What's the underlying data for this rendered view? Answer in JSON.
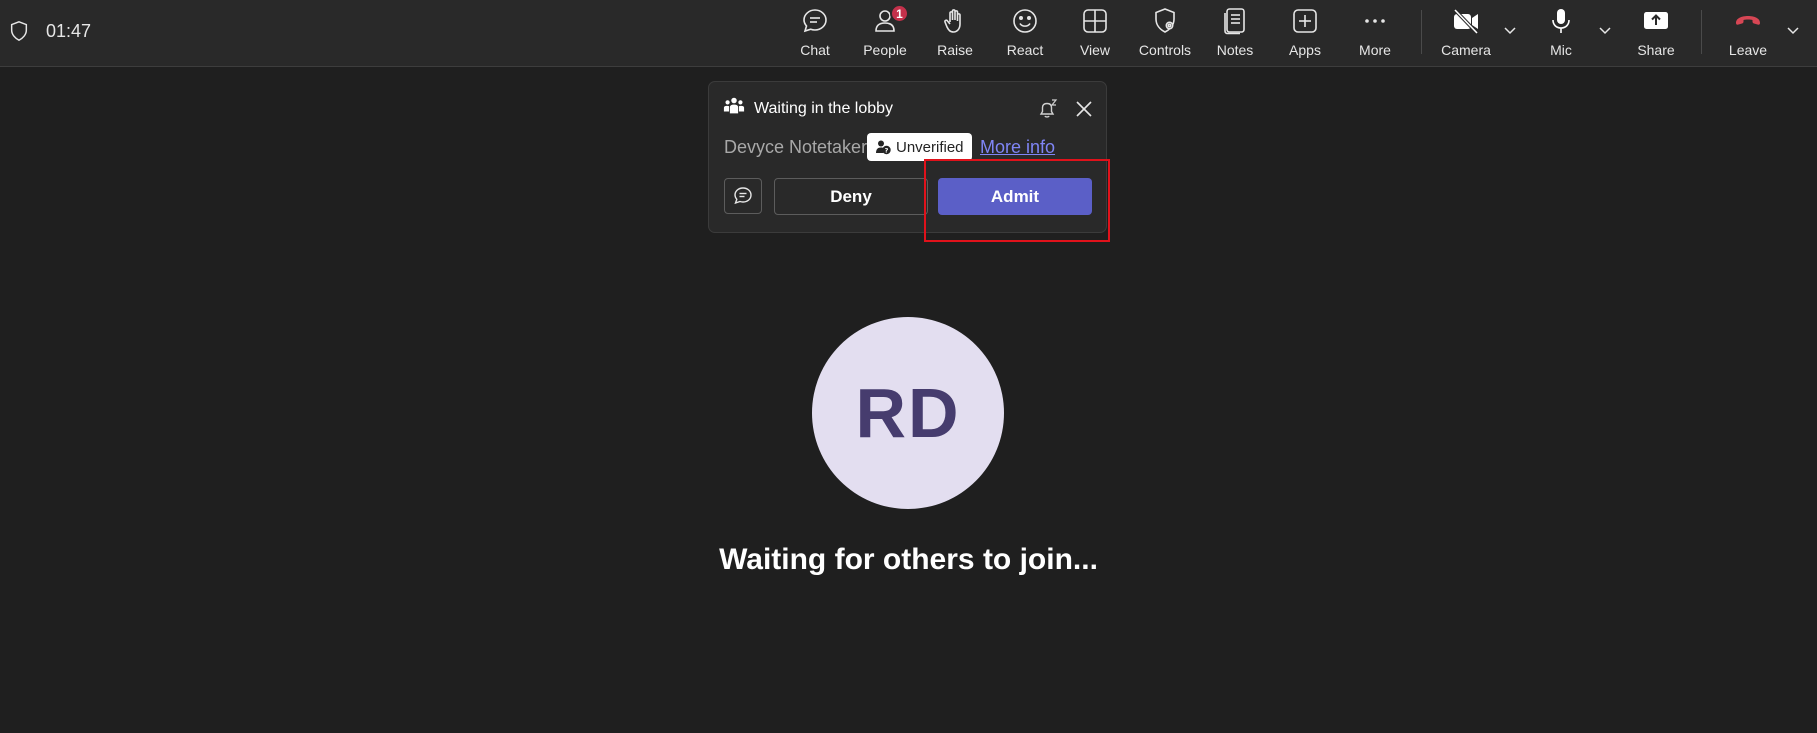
{
  "meeting": {
    "timer": "01:47"
  },
  "toolbar": {
    "chat": "Chat",
    "people": "People",
    "people_badge": "1",
    "raise": "Raise",
    "react": "React",
    "view": "View",
    "controls": "Controls",
    "notes": "Notes",
    "apps": "Apps",
    "more": "More",
    "camera": "Camera",
    "mic": "Mic",
    "share": "Share",
    "leave": "Leave"
  },
  "lobby": {
    "title": "Waiting in the lobby",
    "person_name": "Devyce Notetaker",
    "badge": "Unverified",
    "more_info": "More info",
    "deny": "Deny",
    "admit": "Admit"
  },
  "stage": {
    "avatar_initials": "RD",
    "status": "Waiting for others to join..."
  },
  "colors": {
    "accent": "#5b5fc7",
    "leave": "#d74654",
    "badge": "#c4314b",
    "highlight": "#e0121b",
    "avatar_bg": "#e3def0"
  }
}
